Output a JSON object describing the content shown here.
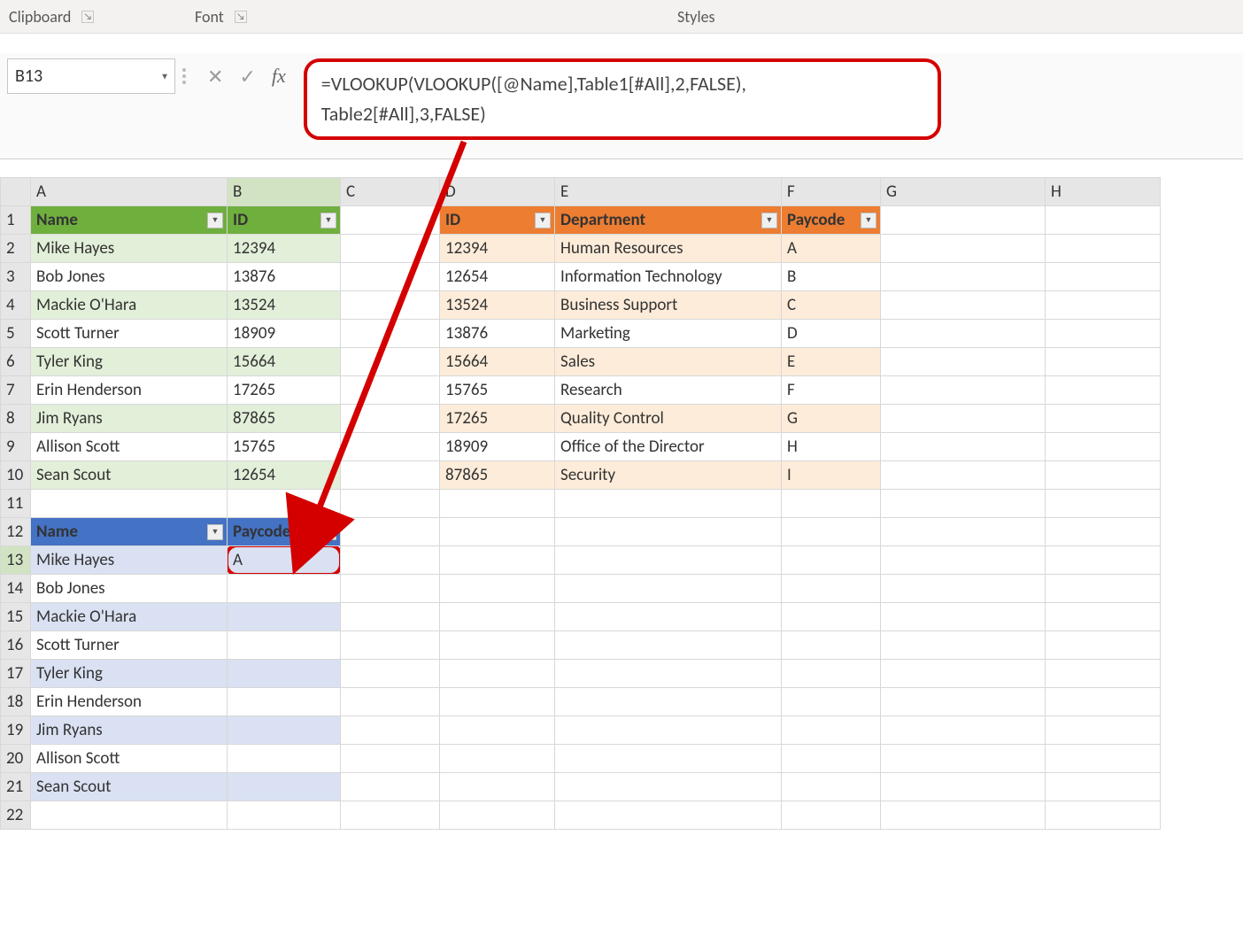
{
  "ribbon": {
    "clipboard": "Clipboard",
    "font": "Font",
    "styles": "Styles"
  },
  "nameBox": "B13",
  "fx": "fx",
  "formula_line1": "=VLOOKUP(VLOOKUP([@Name],Table1[#All],2,FALSE),",
  "formula_line2": "Table2[#All],3,FALSE)",
  "columns": [
    "A",
    "B",
    "C",
    "D",
    "E",
    "F",
    "G",
    "H"
  ],
  "rows": [
    "1",
    "2",
    "3",
    "4",
    "5",
    "6",
    "7",
    "8",
    "9",
    "10",
    "11",
    "12",
    "13",
    "14",
    "15",
    "16",
    "17",
    "18",
    "19",
    "20",
    "21",
    "22"
  ],
  "table1": {
    "hdr_name": "Name",
    "hdr_id": "ID",
    "rows": [
      {
        "name": "Mike Hayes",
        "id": "12394"
      },
      {
        "name": "Bob Jones",
        "id": "13876"
      },
      {
        "name": "Mackie O'Hara",
        "id": "13524"
      },
      {
        "name": "Scott Turner",
        "id": "18909"
      },
      {
        "name": "Tyler King",
        "id": "15664"
      },
      {
        "name": "Erin Henderson",
        "id": "17265"
      },
      {
        "name": "Jim Ryans",
        "id": "87865"
      },
      {
        "name": "Allison Scott",
        "id": "15765"
      },
      {
        "name": "Sean Scout",
        "id": "12654"
      }
    ]
  },
  "table2": {
    "hdr_id": "ID",
    "hdr_dept": "Department",
    "hdr_pay": "Paycode",
    "rows": [
      {
        "id": "12394",
        "dept": "Human Resources",
        "pay": "A"
      },
      {
        "id": "12654",
        "dept": "Information Technology",
        "pay": "B"
      },
      {
        "id": "13524",
        "dept": "Business Support",
        "pay": "C"
      },
      {
        "id": "13876",
        "dept": "Marketing",
        "pay": "D"
      },
      {
        "id": "15664",
        "dept": "Sales",
        "pay": "E"
      },
      {
        "id": "15765",
        "dept": "Research",
        "pay": "F"
      },
      {
        "id": "17265",
        "dept": "Quality Control",
        "pay": "G"
      },
      {
        "id": "18909",
        "dept": "Office of the Director",
        "pay": "H"
      },
      {
        "id": "87865",
        "dept": "Security",
        "pay": "I"
      }
    ]
  },
  "table3": {
    "hdr_name": "Name",
    "hdr_pay": "Paycode",
    "rows": [
      {
        "name": "Mike Hayes",
        "pay": "A"
      },
      {
        "name": "Bob Jones",
        "pay": ""
      },
      {
        "name": "Mackie O'Hara",
        "pay": ""
      },
      {
        "name": "Scott Turner",
        "pay": ""
      },
      {
        "name": "Tyler King",
        "pay": ""
      },
      {
        "name": "Erin Henderson",
        "pay": ""
      },
      {
        "name": "Jim Ryans",
        "pay": ""
      },
      {
        "name": "Allison Scott",
        "pay": ""
      },
      {
        "name": "Sean Scout",
        "pay": ""
      }
    ]
  }
}
